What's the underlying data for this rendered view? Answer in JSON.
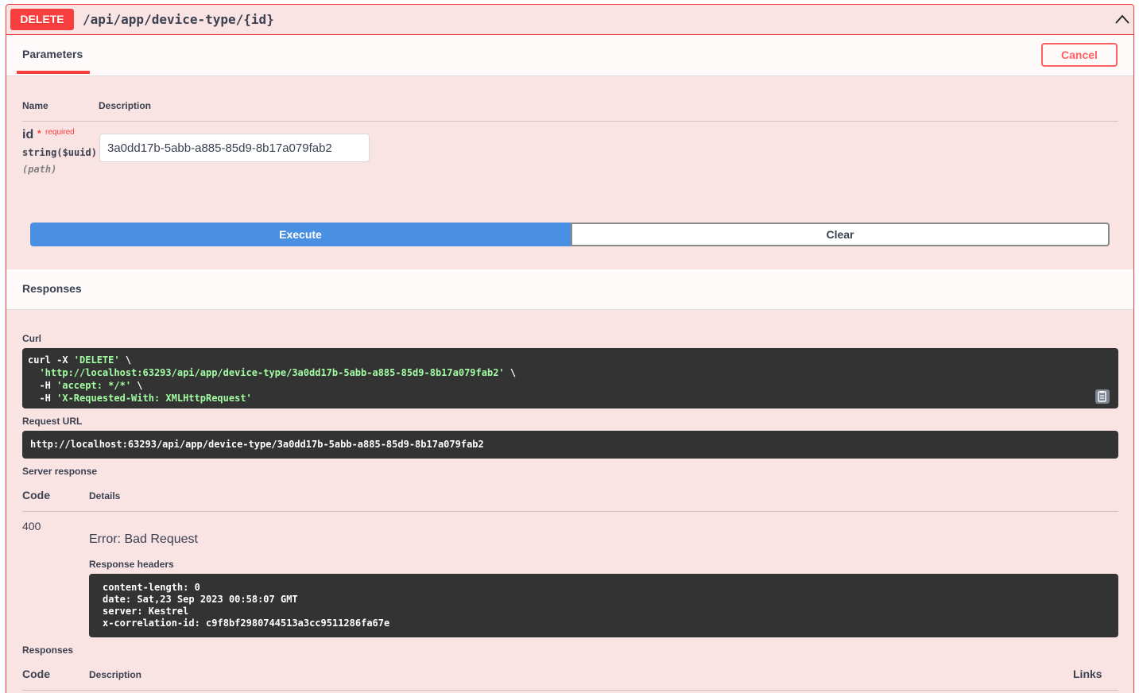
{
  "summary": {
    "method": "DELETE",
    "path": "/api/app/device-type/{id}"
  },
  "parameters": {
    "tab_label": "Parameters",
    "cancel_label": "Cancel",
    "col_name": "Name",
    "col_description": "Description",
    "param": {
      "name": "id",
      "star": "*",
      "required": "required",
      "type": "string($uuid)",
      "in": "(path)",
      "value": "3a0dd17b-5abb-a885-85d9-8b17a079fab2"
    },
    "execute_label": "Execute",
    "clear_label": "Clear"
  },
  "responses": {
    "title": "Responses",
    "curl_label": "Curl",
    "curl": {
      "l1_cmd": "curl -X ",
      "l1_method": "'DELETE'",
      "l1_end": " \\",
      "l2_url": "'http://localhost:63293/api/app/device-type/3a0dd17b-5abb-a885-85d9-8b17a079fab2'",
      "l2_end": " \\",
      "l3_flag": "  -H ",
      "l3_val": "'accept: */*'",
      "l3_end": " \\",
      "l4_flag": "  -H ",
      "l4_val": "'X-Requested-With: XMLHttpRequest'"
    },
    "request_url_label": "Request URL",
    "request_url": "http://localhost:63293/api/app/device-type/3a0dd17b-5abb-a885-85d9-8b17a079fab2",
    "server_response_label": "Server response",
    "col_code": "Code",
    "col_details": "Details",
    "code": "400",
    "error": "Error: Bad Request",
    "headers_label": "Response headers",
    "headers": [
      "content-length: 0",
      "date: Sat,23 Sep 2023 00:58:07 GMT",
      "server: Kestrel",
      "x-correlation-id: c9f8bf2980744513a3cc9511286fa67e"
    ],
    "bottom_label": "Responses",
    "bottom_col_code": "Code",
    "bottom_col_description": "Description",
    "bottom_col_links": "Links"
  },
  "colors": {
    "delete": "#f93e3e",
    "execute": "#4990e2",
    "code_bg": "#333333",
    "curl_string": "#a2fca2"
  },
  "icons": {
    "collapse": "chevron-up-icon",
    "copy": "copy-to-clipboard-icon"
  }
}
